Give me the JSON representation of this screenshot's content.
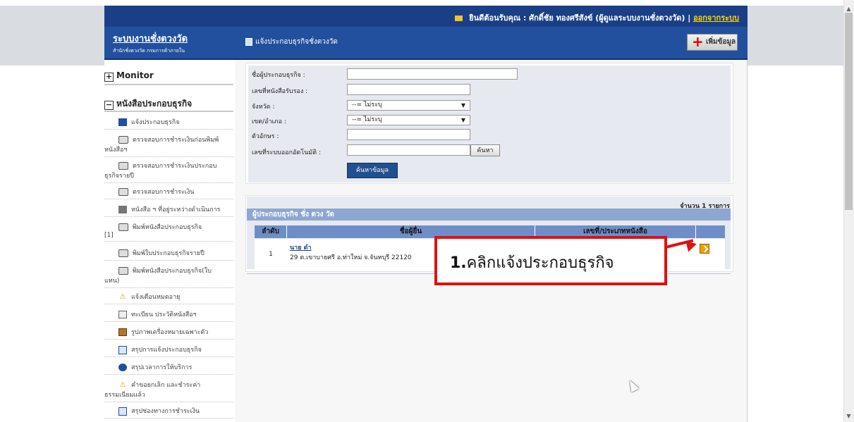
{
  "header": {
    "welcome_text": "ยินดีต้อนรับคุณ : ศักดิ์ชัย ทองศรีสังข์ (ผู้ดูแลระบบงานชั่งตวงวัด) |",
    "logout_link": "ออกจากระบบ",
    "system_title": "ระบบงานชั่งตวงวัด",
    "system_subtitle": "สำนักชั่งตวงวัด กรมการค้าภายใน",
    "section_title": "แจ้งประกอบธุรกิจชั่งตวงวัด",
    "add_button": "เพิ่มข้อมูล"
  },
  "sidebar": {
    "monitor": "Monitor",
    "license_section": "หนังสือประกอบธุรกิจ",
    "items": [
      {
        "icon": "floppy-icon",
        "label": "แจ้งประกอบธุรกิจ",
        "label2": ""
      },
      {
        "icon": "printer-icon",
        "label": "ตรวจสอบการชำระเงินก่อนพิมพ์",
        "label2": "หนังสือฯ"
      },
      {
        "icon": "printer-icon",
        "label": "ตรวจสอบการชำระเงินประกอบ",
        "label2": "ธุรกิจรายปี"
      },
      {
        "icon": "printer-icon",
        "label": "ตรวจสอบการชำระเงิน",
        "label2": ""
      },
      {
        "icon": "edit-icon",
        "label": "หนังสือ ฯ ที่อยู่ระหว่างดำเนินการ",
        "label2": ""
      },
      {
        "icon": "printer-icon",
        "label": "พิมพ์หนังสือประกอบธุรกิจ",
        "label2": "[1]"
      },
      {
        "icon": "printer-icon",
        "label": "พิมพ์ใบประกอบธุรกิจรายปี",
        "label2": ""
      },
      {
        "icon": "printer-icon",
        "label": "พิมพ์หนังสือประกอบธุรกิจ(ใบ",
        "label2": "แทน)"
      },
      {
        "icon": "warning-icon",
        "label": "แจ้งเตือนหมดอายุ",
        "label2": ""
      },
      {
        "icon": "list-icon",
        "label": "ทะเบียน ประวัติหนังสือฯ",
        "label2": ""
      },
      {
        "icon": "picture-icon",
        "label": "รูปภาพเครื่องหมายเฉพาะตัว",
        "label2": ""
      },
      {
        "icon": "summary-icon",
        "label": "สรุปการแจ้งประกอบธุรกิจ",
        "label2": ""
      },
      {
        "icon": "clock-icon",
        "label": "สรุปเวลาการให้บริการ",
        "label2": ""
      },
      {
        "icon": "warning-icon",
        "label": "คำขอยกเลิก และชำระค่า",
        "label2": "ธรรมเนียมแล้ว"
      },
      {
        "icon": "summary-icon",
        "label": "สรุปช่องทางการชำระเงิน",
        "label2": ""
      }
    ]
  },
  "search": {
    "fields": {
      "operator_name": "ชื่อผู้ประกอบธุรกิจ :",
      "cert_no": "เลขที่หนังสือรับรอง :",
      "province": "จังหวัด :",
      "district": "เขต/อำเภอ :",
      "initials": "ตัวอักษร :",
      "auto_no": "เลขที่ระบบออกอัตโนมัติ :"
    },
    "province_value": "--= ไม่ระบุ",
    "district_value": "--= ไม่ระบุ",
    "find_button": "ค้นหา",
    "search_button": "ค้นหาข้อมูล"
  },
  "results": {
    "count": "จำนวน 1 รายการ",
    "title": "ผู้ประกอบธุรกิจ ชั่ง ตวง วัด",
    "columns": [
      "ลำดับ",
      "ชื่อผู้ยื่น",
      "เลขที่/ประเภทหนังสือ",
      ""
    ],
    "rows": [
      {
        "no": "1",
        "name": "นาย ดำ",
        "address": "29 ต.เขาบายศรี อ.ท่าใหม่ จ.จันทบุรี 22120"
      }
    ]
  },
  "callout": {
    "number": "1.",
    "text": "คลิกแจ้งประกอบธุรกิจ"
  }
}
